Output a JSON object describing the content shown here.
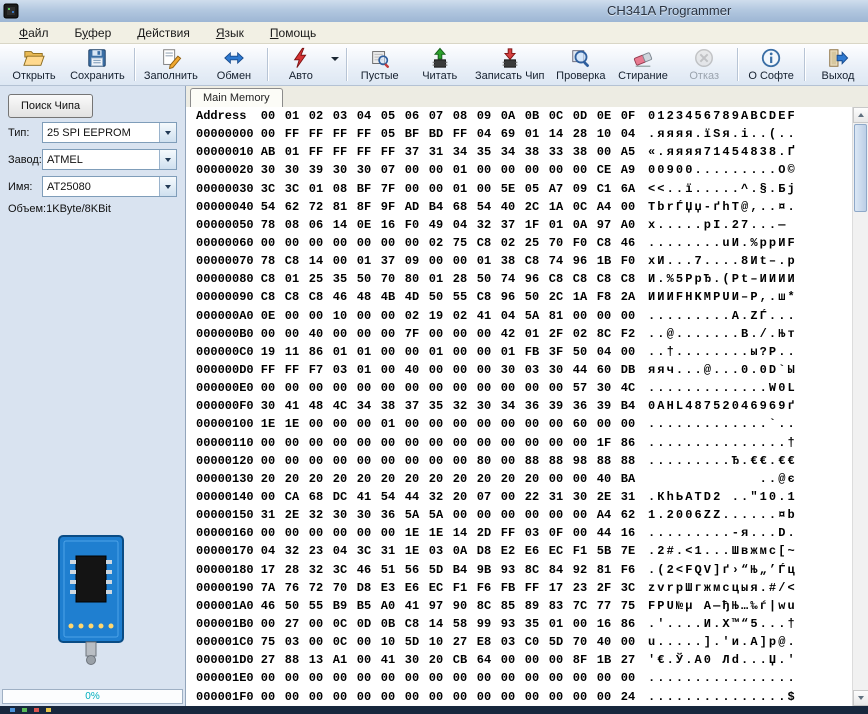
{
  "window": {
    "title": "CH341A Programmer"
  },
  "menu_bar": {
    "items": [
      {
        "label": "Файл",
        "accel_index": 0
      },
      {
        "label": "Буфер",
        "accel_index": 1
      },
      {
        "label": "Действия",
        "accel_index": 0
      },
      {
        "label": "Язык",
        "accel_index": 0
      },
      {
        "label": "Помощь",
        "accel_index": 0
      }
    ]
  },
  "toolbar": {
    "buttons": [
      {
        "id": "open",
        "label": "Открыть",
        "icon": "open-folder-icon",
        "enabled": true
      },
      {
        "id": "save",
        "label": "Сохранить",
        "icon": "save-floppy-icon",
        "enabled": true,
        "sep_after": true
      },
      {
        "id": "fill",
        "label": "Заполнить",
        "icon": "fill-pencil-icon",
        "enabled": true
      },
      {
        "id": "swap",
        "label": "Обмен",
        "icon": "swap-arrows-icon",
        "enabled": true,
        "sep_after": true
      },
      {
        "id": "auto",
        "label": "Авто",
        "icon": "auto-lightning-icon",
        "enabled": true,
        "has_dropdown": true,
        "sep_after": true
      },
      {
        "id": "blank",
        "label": "Пустые",
        "icon": "blank-check-icon",
        "enabled": true
      },
      {
        "id": "read",
        "label": "Читать",
        "icon": "read-chip-icon",
        "enabled": true
      },
      {
        "id": "write",
        "label": "Записать Чип",
        "icon": "write-chip-icon",
        "enabled": true
      },
      {
        "id": "verify",
        "label": "Проверка",
        "icon": "verify-magnifier-icon",
        "enabled": true
      },
      {
        "id": "erase",
        "label": "Стирание",
        "icon": "erase-icon",
        "enabled": true
      },
      {
        "id": "cancel",
        "label": "Отказ",
        "icon": "cancel-icon",
        "enabled": false,
        "sep_after": true
      },
      {
        "id": "about",
        "label": "О Софте",
        "icon": "info-icon",
        "enabled": true,
        "sep_after": true
      },
      {
        "id": "exit",
        "label": "Выход",
        "icon": "exit-icon",
        "enabled": true
      }
    ]
  },
  "chip_panel": {
    "search_button": "Поиск Чипа",
    "fields": [
      {
        "label": "Тип:",
        "value": "25 SPI EEPROM"
      },
      {
        "label": "Завод:",
        "value": "ATMEL"
      },
      {
        "label": "Имя:",
        "value": "AT25080"
      }
    ],
    "capacity_label": "Объем:",
    "capacity_value": "1KByte/8KBit",
    "progress_text": "0%"
  },
  "memory": {
    "tab_label": "Main Memory",
    "address_header": "Address",
    "byte_headers": [
      "00",
      "01",
      "02",
      "03",
      "04",
      "05",
      "06",
      "07",
      "08",
      "09",
      "0A",
      "0B",
      "0C",
      "0D",
      "0E",
      "0F"
    ],
    "ascii_header": "0123456789ABCDEF",
    "rows": [
      {
        "addr": "00000000",
        "bytes": "00 FF FF FF FF 05 BF BD FF 04 69 01 14 28 10 04"
      },
      {
        "addr": "00000010",
        "bytes": "AB 01 FF FF FF FF 37 31 34 35 34 38 33 38 00 A5"
      },
      {
        "addr": "00000020",
        "bytes": "30 30 39 30 30 07 00 00 01 00 00 00 00 00 CE A9"
      },
      {
        "addr": "00000030",
        "bytes": "3C 3C 01 08 BF 7F 00 00 01 00 5E 05 A7 09 C1 6A"
      },
      {
        "addr": "00000040",
        "bytes": "54 62 72 81 8F 9F AD B4 68 54 40 2C 1A 0C A4 00"
      },
      {
        "addr": "00000050",
        "bytes": "78 08 06 14 0E 16 F0 49 04 32 37 1F 01 0A 97 A0"
      },
      {
        "addr": "00000060",
        "bytes": "00 00 00 00 00 00 00 02 75 C8 02 25 70 F0 C8 46"
      },
      {
        "addr": "00000070",
        "bytes": "78 C8 14 00 01 37 09 00 00 01 38 C8 74 96 1B F0"
      },
      {
        "addr": "00000080",
        "bytes": "C8 01 25 35 50 70 80 01 28 50 74 96 C8 C8 C8 C8"
      },
      {
        "addr": "00000090",
        "bytes": "C8 C8 C8 46 48 4B 4D 50 55 C8 96 50 2C 1A F8 2A"
      },
      {
        "addr": "000000A0",
        "bytes": "0E 00 00 10 00 00 02 19 02 41 04 5A 81 00 00 00"
      },
      {
        "addr": "000000B0",
        "bytes": "00 00 40 00 00 00 7F 00 00 00 42 01 2F 02 8C F2"
      },
      {
        "addr": "000000C0",
        "bytes": "19 11 86 01 01 00 00 01 00 00 01 FB 3F 50 04 00"
      },
      {
        "addr": "000000D0",
        "bytes": "FF FF F7 03 01 00 40 00 00 00 30 03 30 44 60 DB"
      },
      {
        "addr": "000000E0",
        "bytes": "00 00 00 00 00 00 00 00 00 00 00 00 00 57 30 4C"
      },
      {
        "addr": "000000F0",
        "bytes": "30 41 48 4C 34 38 37 35 32 30 34 36 39 36 39 B4"
      },
      {
        "addr": "00000100",
        "bytes": "1E 1E 00 00 00 01 00 00 00 00 00 00 00 60 00 00"
      },
      {
        "addr": "00000110",
        "bytes": "00 00 00 00 00 00 00 00 00 00 00 00 00 00 1F 86"
      },
      {
        "addr": "00000120",
        "bytes": "00 00 00 00 00 00 00 00 00 80 00 88 88 98 88 88"
      },
      {
        "addr": "00000130",
        "bytes": "20 20 20 20 20 20 20 20 20 20 20 20 00 00 40 BA"
      },
      {
        "addr": "00000140",
        "bytes": "00 CA 68 DC 41 54 44 32 20 07 00 22 31 30 2E 31"
      },
      {
        "addr": "00000150",
        "bytes": "31 2E 32 30 30 36 5A 5A 00 00 00 00 00 00 A4 62"
      },
      {
        "addr": "00000160",
        "bytes": "00 00 00 00 00 00 1E 1E 14 2D FF 03 0F 00 44 16"
      },
      {
        "addr": "00000170",
        "bytes": "04 32 23 04 3C 31 1E 03 0A D8 E2 E6 EC F1 5B 7E"
      },
      {
        "addr": "00000180",
        "bytes": "17 28 32 3C 46 51 56 5D B4 9B 93 8C 84 92 81 F6"
      },
      {
        "addr": "00000190",
        "bytes": "7A 76 72 70 D8 E3 E6 EC F1 F6 FB FF 17 23 2F 3C"
      },
      {
        "addr": "000001A0",
        "bytes": "46 50 55 B9 B5 A0 41 97 90 8C 85 89 83 7C 77 75"
      },
      {
        "addr": "000001B0",
        "bytes": "00 27 00 0C 0D 0B C8 14 58 99 93 35 01 00 16 86"
      },
      {
        "addr": "000001C0",
        "bytes": "75 03 00 0C 00 10 5D 10 27 E8 03 C0 5D 70 40 00"
      },
      {
        "addr": "000001D0",
        "bytes": "27 88 13 A1 00 41 30 20 CB 64 00 00 00 8F 1B 27"
      },
      {
        "addr": "000001E0",
        "bytes": "00 00 00 00 00 00 00 00 00 00 00 00 00 00 00 00"
      },
      {
        "addr": "000001F0",
        "bytes": "00 00 00 00 00 00 00 00 00 00 00 00 00 00 00 24"
      }
    ]
  },
  "colors": {
    "progress_text": "#00aebe",
    "pcb_blue": "#1f7fd0",
    "titlebar_top": "#cfdded",
    "titlebar_bottom": "#9db6d4"
  }
}
